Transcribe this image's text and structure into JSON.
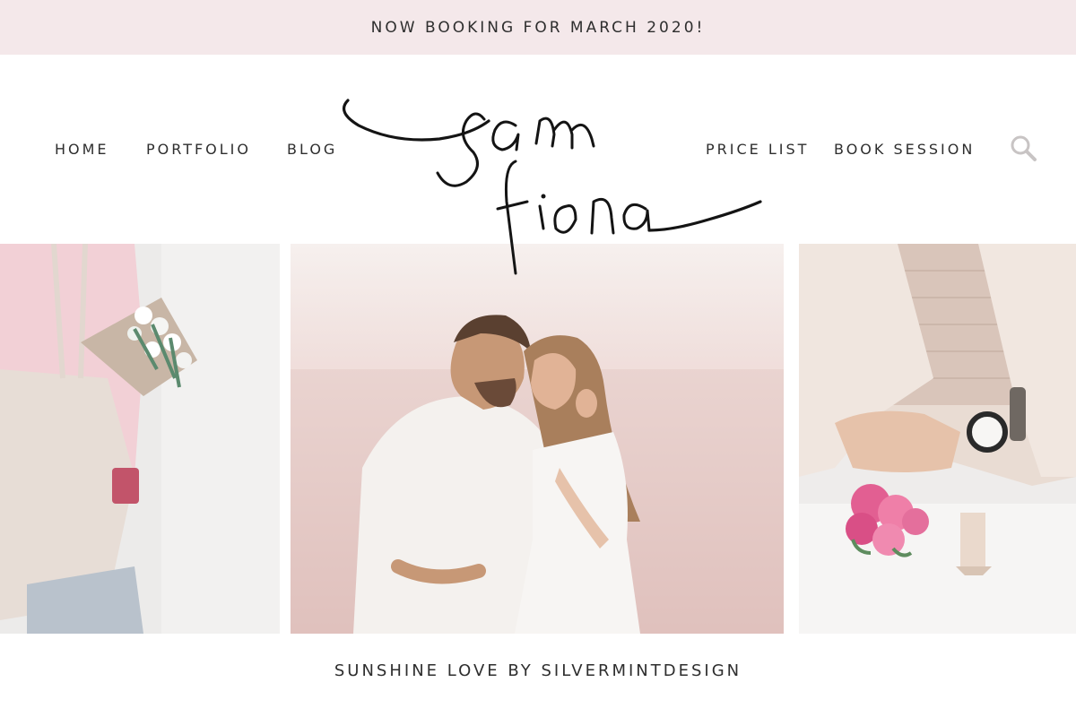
{
  "banner": {
    "text": "NOW BOOKING FOR MARCH 2020!"
  },
  "nav": {
    "left": [
      {
        "label": "HOME"
      },
      {
        "label": "PORTFOLIO"
      },
      {
        "label": "BLOG"
      }
    ],
    "right": [
      {
        "label": "PRICE LIST"
      },
      {
        "label": "BOOK SESSION"
      }
    ],
    "search_icon": "search-icon"
  },
  "logo": {
    "line1": "sam",
    "line2": "fiona"
  },
  "gallery": [
    {
      "subject": "person with canvas tote bag and white flowers"
    },
    {
      "subject": "couple embracing at sunset"
    },
    {
      "subject": "hands with watch holding pink peonies"
    }
  ],
  "footer": {
    "caption": "SUNSHINE LOVE BY SILVERMINTDESIGN"
  },
  "colors": {
    "banner_bg": "#f4e8ea",
    "text": "#2e2e2e",
    "icon": "#c8c4c4"
  }
}
